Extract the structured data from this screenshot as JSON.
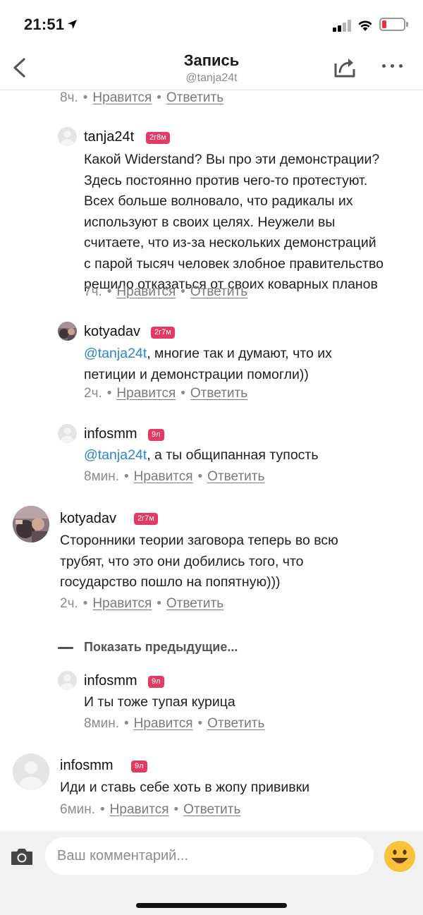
{
  "status": {
    "time": "21:51"
  },
  "header": {
    "title": "Запись",
    "subtitle": "@tanja24t"
  },
  "top_meta": {
    "time": "8ч.",
    "like": "Нравится",
    "reply": "Ответить"
  },
  "comments": [
    {
      "username": "tanja24t",
      "badge": "2г8м",
      "lines": [
        "Какой Widerstand? Вы про эти демонстрации?",
        "Здесь постоянно против чего-то протестуют.",
        "Всех больше волновало, что радикалы их",
        "используют в своих целях. Неужели вы",
        "считаете, что из-за нескольких демонстраций",
        "с парой тысяч человек злобное правительство",
        "решило отказаться от своих коварных планов"
      ],
      "time": "7ч.",
      "like": "Нравится",
      "reply": "Ответить"
    },
    {
      "username": "kotyadav",
      "badge": "2г7м",
      "mention": "@tanja24t",
      "line1_rest": ", многие так и думают, что их",
      "line2": "петиции и демонстрации помогли))",
      "time": "2ч.",
      "like": "Нравится",
      "reply": "Ответить"
    },
    {
      "username": "infosmm",
      "badge": "9л",
      "mention": "@tanja24t",
      "line1_rest": ", а ты общипанная тупость",
      "time": "8мин.",
      "like": "Нравится",
      "reply": "Ответить"
    },
    {
      "username": "kotyadav",
      "badge": "2г7м",
      "lines": [
        "Сторонники теории заговора теперь во всю",
        "трубят, что это они добились того, что",
        "государство пошло на попятную)))"
      ],
      "time": "2ч.",
      "like": "Нравится",
      "reply": "Ответить"
    },
    {
      "username": "infosmm",
      "badge": "9л",
      "lines": [
        "И ты тоже тупая курица"
      ],
      "time": "8мин.",
      "like": "Нравится",
      "reply": "Ответить"
    },
    {
      "username": "infosmm",
      "badge": "9л",
      "lines": [
        "Иди и ставь себе хоть в жопу прививки"
      ],
      "time": "6мин.",
      "like": "Нравится",
      "reply": "Ответить"
    }
  ],
  "show_previous": "Показать предыдущие...",
  "composer": {
    "placeholder": "Ваш комментарий..."
  },
  "colors": {
    "badge": "#e53965",
    "mention": "#2f86c9",
    "muted": "#8b8b8b"
  },
  "icons": [
    "back-chevron-icon",
    "share-icon",
    "more-icon",
    "camera-icon",
    "smiley-emoji-icon"
  ]
}
